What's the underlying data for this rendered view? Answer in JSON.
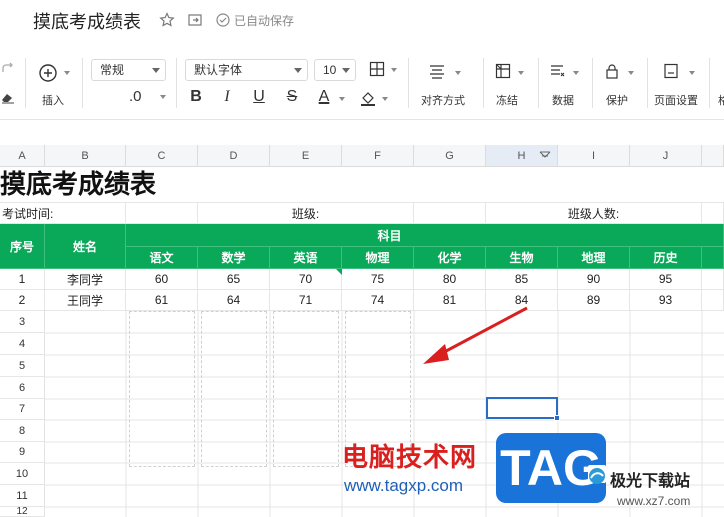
{
  "title_bar": {
    "doc_title": "摸底考成绩表",
    "saved_status": "已自动保存"
  },
  "ribbon": {
    "insert_label": "插入",
    "number_format": "常规",
    "decimal_label": ".0",
    "font_family": "默认字体",
    "font_size": "10",
    "bold": "B",
    "italic": "I",
    "underline": "U",
    "strike": "S",
    "font_color": "A",
    "align_label": "对齐方式",
    "freeze_label": "冻结",
    "data_label": "数据",
    "protect_label": "保护",
    "page_setup_label": "页面设置",
    "overflow_label": "格"
  },
  "grid": {
    "columns": [
      "A",
      "B",
      "C",
      "D",
      "E",
      "F",
      "G",
      "H",
      "I",
      "J"
    ],
    "row_numbers": [
      "1",
      "2",
      "3",
      "4",
      "5",
      "6",
      "7",
      "8",
      "9",
      "10",
      "11",
      "12"
    ],
    "sheet_title": "摸底考成绩表",
    "info_row": {
      "exam_time": "考试时间:",
      "class": "班级:",
      "class_size": "班级人数:"
    },
    "headers": {
      "seq": "序号",
      "name": "姓名",
      "subject": "科目",
      "subjects": [
        "语文",
        "数学",
        "英语",
        "物理",
        "化学",
        "生物",
        "地理",
        "历史"
      ]
    },
    "students": [
      {
        "seq": "1",
        "name": "李同学",
        "scores": [
          "60",
          "65",
          "70",
          "75",
          "80",
          "85",
          "90",
          "95"
        ]
      },
      {
        "seq": "2",
        "name": "王同学",
        "scores": [
          "61",
          "64",
          "71",
          "74",
          "81",
          "84",
          "89",
          "93"
        ]
      }
    ],
    "empty_seqs": [
      "3",
      "4",
      "5",
      "6",
      "7",
      "8",
      "9",
      "10",
      "11",
      "12"
    ]
  },
  "watermark": {
    "site_name": "电脑技术网",
    "site_url": "www.tagxp.com",
    "tag_logo": "TAG",
    "brand": "极光下载站",
    "brand_url": "www.xz7.com"
  },
  "colors": {
    "header_green": "#0aa859",
    "selection_blue": "#2b6cc4",
    "arrow_red": "#d9201e"
  }
}
